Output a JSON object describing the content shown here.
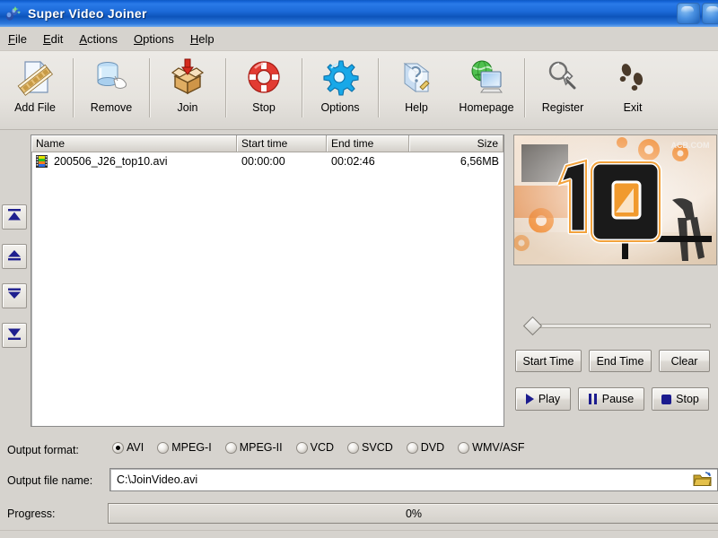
{
  "window": {
    "title": "Super Video Joiner",
    "icon": "app-icon",
    "controls": [
      "minimize-button",
      "maximize-button"
    ]
  },
  "menu": {
    "items": [
      {
        "label": "File",
        "accel": "F"
      },
      {
        "label": "Edit",
        "accel": "E"
      },
      {
        "label": "Actions",
        "accel": "A"
      },
      {
        "label": "Options",
        "accel": "O"
      },
      {
        "label": "Help",
        "accel": "H"
      }
    ]
  },
  "toolbar": {
    "buttons": [
      {
        "label": "Add File",
        "icon": "add-file-icon"
      },
      {
        "label": "Remove",
        "icon": "remove-icon"
      },
      {
        "label": "Join",
        "icon": "join-box-icon"
      },
      {
        "label": "Stop",
        "icon": "stop-lifebuoy-icon"
      },
      {
        "label": "Options",
        "icon": "gear-icon"
      },
      {
        "label": "Help",
        "icon": "help-pen-icon"
      },
      {
        "label": "Homepage",
        "icon": "homepage-globe-icon"
      },
      {
        "label": "Register",
        "icon": "register-key-icon"
      },
      {
        "label": "Exit",
        "icon": "exit-footprints-icon"
      }
    ]
  },
  "order_buttons": [
    {
      "name": "move-to-top-button",
      "icon": "double-up-arrow-icon"
    },
    {
      "name": "move-up-button",
      "icon": "up-arrow-icon"
    },
    {
      "name": "move-down-button",
      "icon": "down-arrow-icon"
    },
    {
      "name": "move-to-bottom-button",
      "icon": "double-down-arrow-icon"
    }
  ],
  "file_list": {
    "columns": [
      "Name",
      "Start time",
      "End time",
      "Size"
    ],
    "rows": [
      {
        "icon": "film-strip-icon",
        "name": "200506_J26_top10.avi",
        "start_time": "00:00:00",
        "end_time": "00:02:46",
        "size": "6,56MB"
      }
    ]
  },
  "preview": {
    "watermark": "ACB.COM",
    "frame_text": "10"
  },
  "player": {
    "seek_value": 0,
    "buttons": {
      "start_time": "Start Time",
      "end_time": "End Time",
      "clear": "Clear",
      "play": "Play",
      "pause": "Pause",
      "stop": "Stop"
    }
  },
  "output": {
    "format_label": "Output format:",
    "formats": [
      {
        "label": "AVI",
        "selected": true
      },
      {
        "label": "MPEG-I",
        "selected": false
      },
      {
        "label": "MPEG-II",
        "selected": false
      },
      {
        "label": "VCD",
        "selected": false
      },
      {
        "label": "SVCD",
        "selected": false
      },
      {
        "label": "DVD",
        "selected": false
      },
      {
        "label": "WMV/ASF",
        "selected": false
      }
    ],
    "file_label": "Output file name:",
    "file_value": "C:\\JoinVideo.avi",
    "browse_icon": "folder-open-icon"
  },
  "progress": {
    "label": "Progress:",
    "value": "0%",
    "percent": 0
  },
  "colors": {
    "titlebar_blue": "#1565d8",
    "face": "#d6d3ce",
    "navy_glyph": "#1b1b8e",
    "order_arrow": "#1f1f8f"
  }
}
